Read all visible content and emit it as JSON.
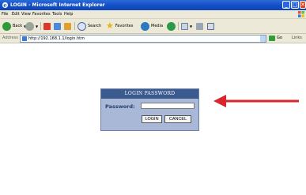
{
  "window": {
    "title": "LOGIN - Microsoft Internet Explorer"
  },
  "menu": [
    "File",
    "Edit",
    "View",
    "Favorites",
    "Tools",
    "Help"
  ],
  "toolbar": {
    "back_label": "Back",
    "search_label": "Search",
    "favorites_label": "Favorites",
    "media_label": "Media"
  },
  "address": {
    "label": "Address",
    "url": "http://192.168.1.1/login.htm",
    "go_label": "Go",
    "links_label": "Links"
  },
  "login": {
    "header": "LOGIN PASSWORD",
    "password_label": "Password:",
    "password_value": "",
    "login_button": "LOGIN",
    "cancel_button": "CANCEL"
  },
  "annotation": {
    "arrow_color": "#d9262a"
  }
}
